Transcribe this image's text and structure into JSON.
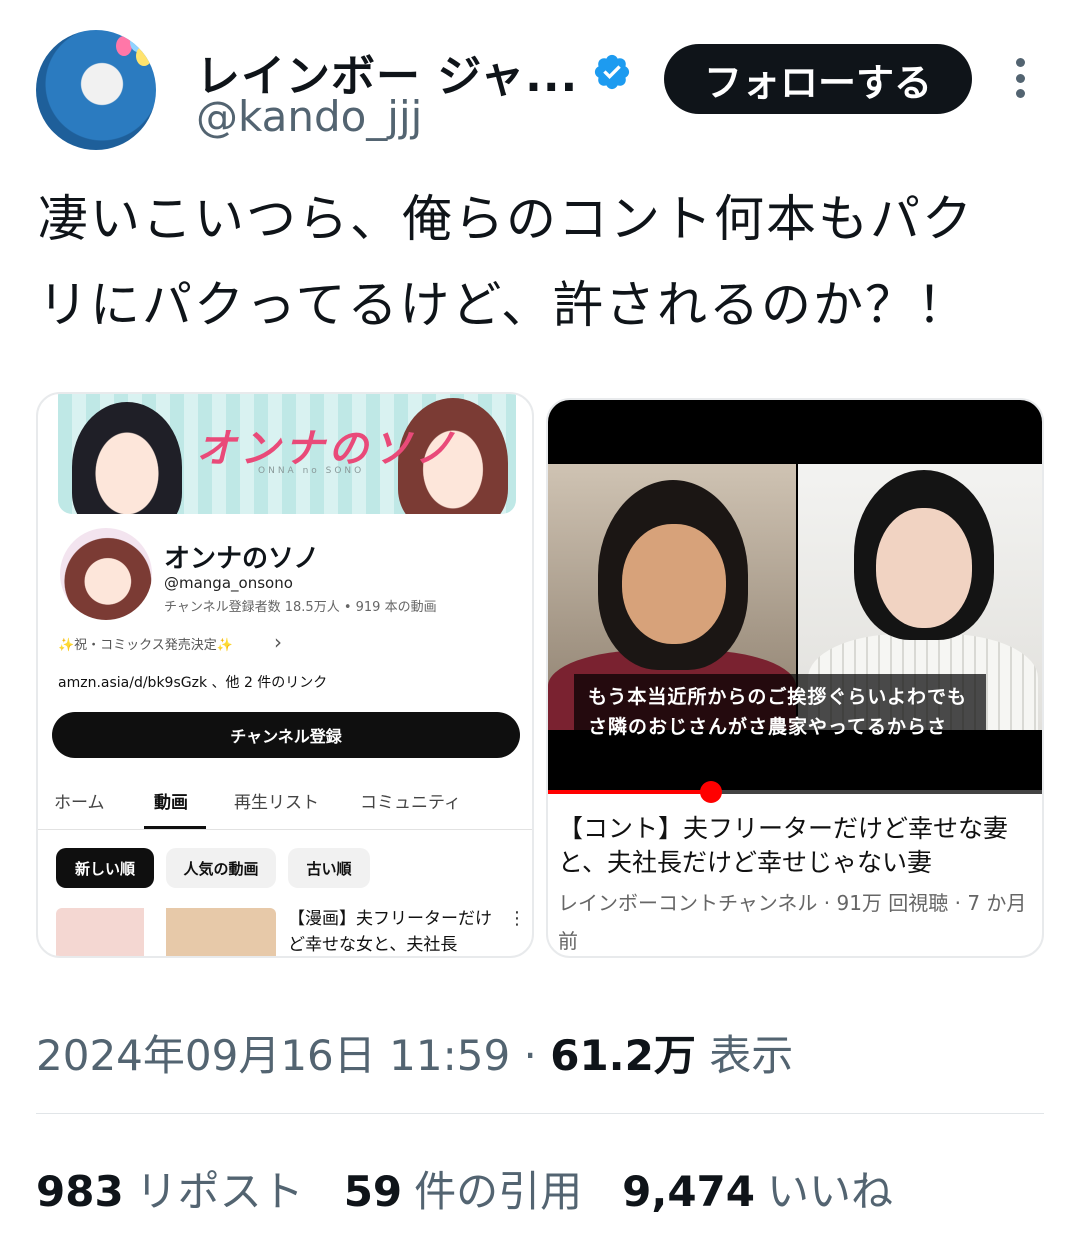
{
  "author": {
    "display_name": "レインボー ジャ...",
    "handle": "@kando_jjj",
    "verified": true,
    "follow_label": "フォローする"
  },
  "tweet": {
    "text_line1": "凄いこいつら、俺らのコント何本もパク",
    "text_line2": "リにパクってるけど、許されるのか？！"
  },
  "left_card": {
    "banner_logo": "オンナのソノ",
    "banner_sub": "ONNA no SONO",
    "channel_name": "オンナのソノ",
    "channel_handle": "@manga_onsono",
    "channel_stats": "チャンネル登録者数 18.5万人 • 919 本の動画",
    "promo": "✨祝・コミックス発売決定✨",
    "link": "amzn.asia/d/bk9sGzk 、他 2 件のリンク",
    "subscribe_label": "チャンネル登録",
    "tabs": [
      "ホーム",
      "動画",
      "再生リスト",
      "コミュニティ"
    ],
    "active_tab_index": 1,
    "chips": [
      "新しい順",
      "人気の動画",
      "古い順"
    ],
    "video_title": "【漫画】夫フリーターだけど幸せな女と、夫社長"
  },
  "right_card": {
    "caption_line1": "もう本当近所からのご挨拶ぐらいよわでも",
    "caption_line2": "さ隣のおじさんがさ農家やってるからさ",
    "progress": 0.33,
    "title": "【コント】夫フリーターだけど幸せな妻と、夫社長だけど幸せじゃない妻",
    "meta": "レインボーコントチャンネル · 91万 回視聴 · 7 か月前"
  },
  "footer": {
    "timestamp": "2024年09月16日 11:59 · ",
    "views_value": "61.2万",
    "views_label": " 表示",
    "reposts_value": "983",
    "reposts_label": "リポスト",
    "quotes_value": "59",
    "quotes_label": "件の引用",
    "likes_value": "9,474",
    "likes_label": "いいね"
  },
  "colors": {
    "verified_blue": "#1d9bf0",
    "text_primary": "#0f1419",
    "text_secondary": "#536471",
    "youtube_red": "#ff0000"
  },
  "icons": {
    "verified": "verified-badge-icon",
    "more": "more-vertical-icon"
  }
}
